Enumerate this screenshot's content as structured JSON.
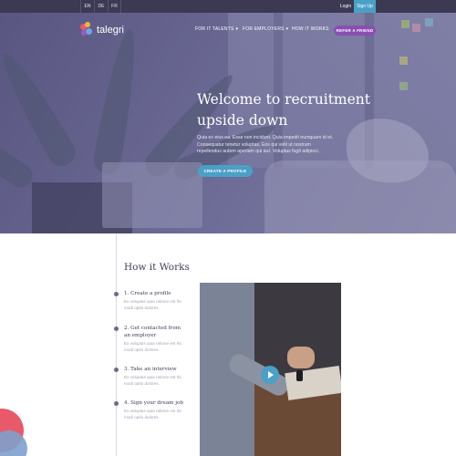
{
  "topbar": {
    "languages": [
      "EN",
      "DE",
      "FR"
    ],
    "login": "Login",
    "signup": "Sign Up"
  },
  "brand": {
    "name": "talegri"
  },
  "nav": {
    "for_talents": "FOR IT TALENTS",
    "for_employers": "FOR EMPLOYERS",
    "how_it_works": "HOW IT WORKS",
    "refer": "REFER A FRIEND"
  },
  "hero": {
    "title_line1": "Welcome to recruitment",
    "title_line2": "upside down",
    "description": "Quia ex eius ea. Esse non incidunt. Quia impedit numquam id et. Consequatur tenetur voluptas. Eos qui velit ut nostrum repellendus autem aperiam qui aut. Voluptas fugit adipisci.",
    "cta": "CREATE A PROFILE"
  },
  "how": {
    "title": "How it Works",
    "steps": [
      {
        "title": "1. Create a profile",
        "desc": "Ex voluptas quia ratione est hic modi optio dolores."
      },
      {
        "title": "2. Get contacted from an employer",
        "desc": "Ex voluptas quia ratione est hic modi optio dolores."
      },
      {
        "title": "3. Take an interview",
        "desc": "Ex voluptas quia ratione est hic modi optio dolores."
      },
      {
        "title": "4. Sign your dream job",
        "desc": "Ex voluptas quia ratione est hic modi optio dolores."
      }
    ]
  },
  "colors": {
    "accent_blue": "#4aa0c6",
    "accent_purple": "#8a4fb0",
    "heading": "#3d3c5a"
  },
  "icons": {
    "play": "play-icon",
    "caret": "chevron-down-icon"
  }
}
